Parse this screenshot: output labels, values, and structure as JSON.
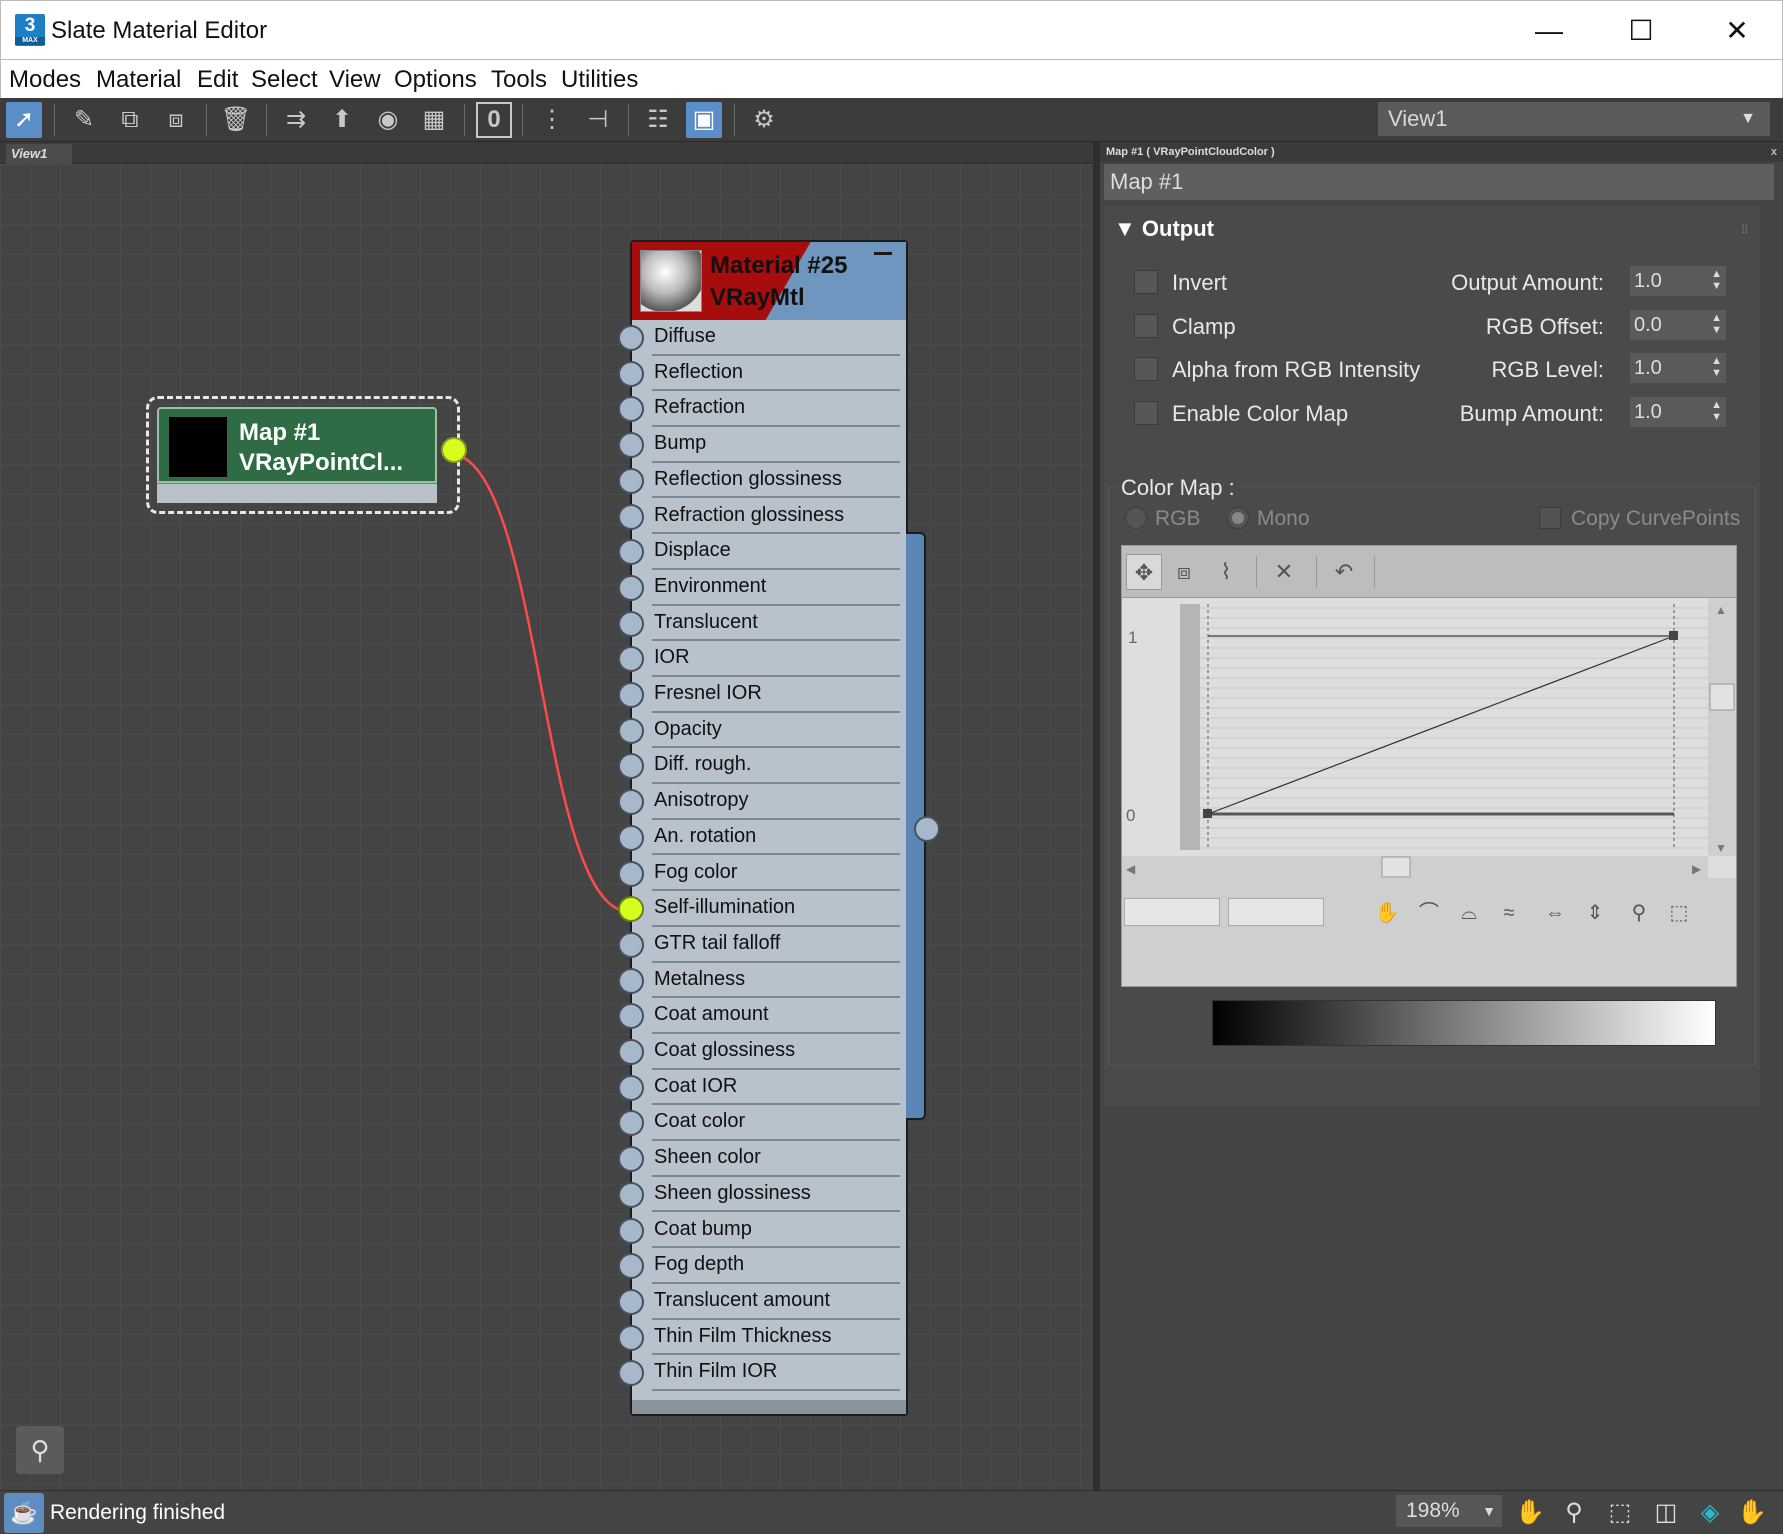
{
  "window": {
    "title": "Slate Material Editor",
    "app_icon_text": "3",
    "app_icon_sub": "MAX",
    "minimize_glyph": "—",
    "maximize_glyph": "☐",
    "close_glyph": "✕"
  },
  "menu": [
    "Modes",
    "Material",
    "Edit",
    "Select",
    "View",
    "Options",
    "Tools",
    "Utilities"
  ],
  "toolbar": {
    "view_dropdown": "View1",
    "zero_label": "0",
    "icons": [
      "select-arrow-icon",
      "eyedropper-icon",
      "put-material-icon",
      "assign-material-icon",
      "delete-icon",
      "move-children-icon",
      "highlight-icon",
      "show-shaded-icon",
      "show-background-icon",
      "material-id-icon",
      "layout-all-icon",
      "layout-children-icon",
      "hide-unused-icon",
      "show-map-viewport-icon",
      "render-preview-icon"
    ]
  },
  "view_tab": "View1",
  "nodes": {
    "map": {
      "title": "Map #1",
      "subtitle": "VRayPointCl..."
    },
    "material": {
      "title": "Material #25",
      "subtitle": "VRayMtl",
      "slots": [
        "Diffuse",
        "Reflection",
        "Refraction",
        "Bump",
        "Reflection glossiness",
        "Refraction glossiness",
        "Displace",
        "Environment",
        "Translucent",
        "IOR",
        "Fresnel IOR",
        "Opacity",
        "Diff. rough.",
        "Anisotropy",
        "An. rotation",
        "Fog color",
        "Self-illumination",
        "GTR tail falloff",
        "Metalness",
        "Coat amount",
        "Coat glossiness",
        "Coat IOR",
        "Coat color",
        "Sheen color",
        "Sheen glossiness",
        "Coat bump",
        "Fog depth",
        "Translucent amount",
        "Thin Film Thickness",
        "Thin Film IOR"
      ],
      "connected_slot": "Self-illumination"
    },
    "wire_color": "#ff4a4a",
    "socket_connected_color": "#d7ff1e"
  },
  "panel": {
    "header": "Map #1  ( VRayPointCloudColor )",
    "close_glyph": "x",
    "map_name": "Map #1",
    "rollout_title": "Output",
    "checkboxes": [
      {
        "label": "Invert",
        "checked": false
      },
      {
        "label": "Clamp",
        "checked": false
      },
      {
        "label": "Alpha from RGB Intensity",
        "checked": false
      },
      {
        "label": "Enable Color Map",
        "checked": false
      }
    ],
    "spinners": [
      {
        "label": "Output Amount:",
        "value": "1.0"
      },
      {
        "label": "RGB Offset:",
        "value": "0.0"
      },
      {
        "label": "RGB Level:",
        "value": "1.0"
      },
      {
        "label": "Bump Amount:",
        "value": "1.0"
      }
    ],
    "color_map": {
      "title": "Color Map :",
      "radio_rgb": "RGB",
      "radio_mono": "Mono",
      "copy_curve_points": "Copy CurvePoints",
      "y_top_label": "1",
      "y_bottom_label": "0"
    }
  },
  "status": {
    "text": "Rendering finished",
    "zoom": "198%"
  }
}
